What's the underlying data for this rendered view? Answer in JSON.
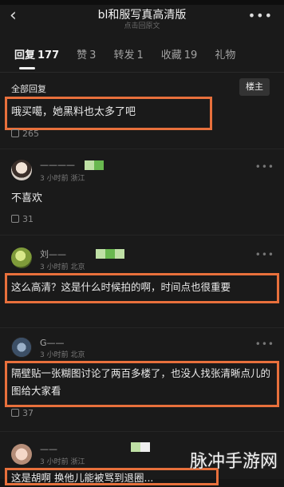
{
  "header": {
    "title": "bl和服写真高清版",
    "subtitle": "点击回原文",
    "back_icon": "‹",
    "more_icon": "•••"
  },
  "tabs": [
    {
      "label": "回复",
      "count": "177",
      "active": true
    },
    {
      "label": "赞",
      "count": "3",
      "active": false
    },
    {
      "label": "转发",
      "count": "1",
      "active": false
    },
    {
      "label": "收藏",
      "count": "19",
      "active": false
    },
    {
      "label": "礼物",
      "count": "",
      "active": false
    }
  ],
  "section": {
    "label": "全部回复",
    "op_button": "楼主"
  },
  "comments": [
    {
      "text": "哦买噶，她黑料也太多了吧",
      "likes": "265"
    },
    {
      "name": "————",
      "meta": "3 小时前  浙江",
      "text": "不喜欢",
      "likes": "31"
    },
    {
      "name": "刘——",
      "meta": "3 小时前  北京",
      "text": "这么高清？这是什么时候拍的啊，时间点也很重要",
      "likes": ""
    },
    {
      "name": "G——",
      "meta": "3 小时前  北京",
      "text": "隔壁贴一张糊图讨论了两百多楼了，也没人找张清晰点儿的图给大家看",
      "likes": "37"
    },
    {
      "name": "——",
      "meta": "3 小时前  浙江",
      "text": "这是胡啊 换他儿能被骂到退圈...",
      "likes": ""
    }
  ],
  "colors": {
    "highlight": "#e8703c",
    "background": "#1a1a1a"
  },
  "watermark": "脉冲手游网"
}
